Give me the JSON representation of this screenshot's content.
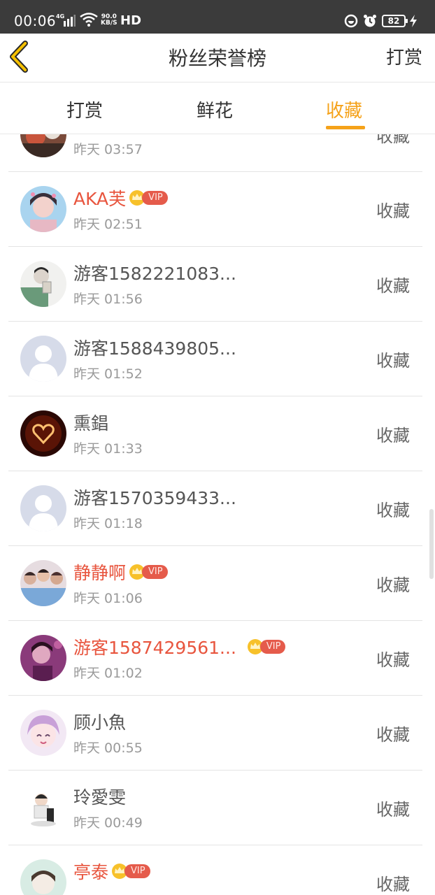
{
  "status_bar": {
    "time": "00:06",
    "network": "4G",
    "speed_value": "90.0",
    "speed_unit": "KB/S",
    "hd": "HD",
    "battery": "82"
  },
  "header": {
    "title": "粉丝荣誉榜",
    "action": "打赏"
  },
  "tabs": [
    {
      "label": "打赏",
      "active": false
    },
    {
      "label": "鲜花",
      "active": false
    },
    {
      "label": "收藏",
      "active": true
    }
  ],
  "accent_color": "#f5a21a",
  "vip_color": "#e8553e",
  "vip_label": "VIP",
  "fans": [
    {
      "name": "",
      "time": "昨天 03:57",
      "action": "收藏",
      "vip": false
    },
    {
      "name": "AKA芙",
      "time": "昨天 02:51",
      "action": "收藏",
      "vip": true
    },
    {
      "name": "游客1582221083...",
      "time": "昨天 01:56",
      "action": "收藏",
      "vip": false
    },
    {
      "name": "游客1588439805...",
      "time": "昨天 01:52",
      "action": "收藏",
      "vip": false
    },
    {
      "name": "熏錩",
      "time": "昨天 01:33",
      "action": "收藏",
      "vip": false
    },
    {
      "name": "游客1570359433...",
      "time": "昨天 01:18",
      "action": "收藏",
      "vip": false
    },
    {
      "name": "静静啊",
      "time": "昨天 01:06",
      "action": "收藏",
      "vip": true
    },
    {
      "name": "游客1587429561...",
      "time": "昨天 01:02",
      "action": "收藏",
      "vip": true
    },
    {
      "name": "顾小魚",
      "time": "昨天 00:55",
      "action": "收藏",
      "vip": false
    },
    {
      "name": "玲愛雯",
      "time": "昨天 00:49",
      "action": "收藏",
      "vip": false
    },
    {
      "name": "亭泰",
      "time": "",
      "action": "收藏",
      "vip": true
    }
  ]
}
